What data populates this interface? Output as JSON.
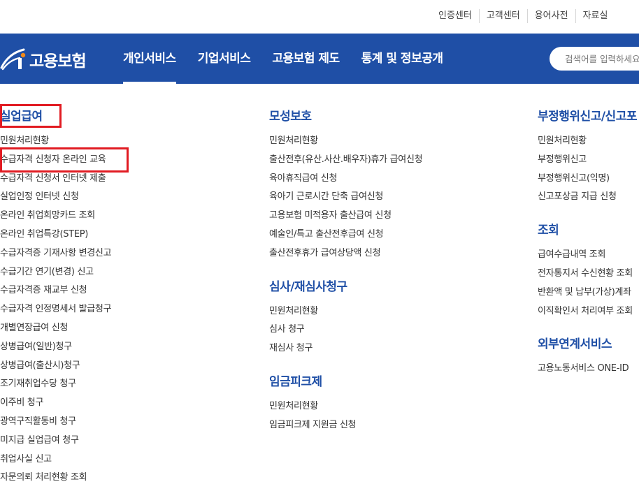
{
  "utility_links": [
    "인증센터",
    "고객센터",
    "용어사전",
    "자료실"
  ],
  "header": {
    "logo_text": "고용보험",
    "nav": [
      "개인서비스",
      "기업서비스",
      "고용보험 제도",
      "통계 및 정보공개"
    ],
    "active_nav": "개인서비스",
    "search_placeholder": "검색어를 입력하세요",
    "brand_color": "#1f4fa6",
    "highlight_color": "#e11b22"
  },
  "columns": {
    "col1": {
      "sections": [
        {
          "title": "실업급여",
          "items": [
            "민원처리현황",
            "수급자격 신청자 온라인 교육",
            "수급자격 신청서 인터넷 제출",
            "실업인정 인터넷 신청",
            "온라인 취업희망카드 조회",
            "온라인 취업특강(STEP)",
            "수급자격증 기재사항 변경신고",
            "수급기간 연기(변경) 신고",
            "수급자격증 재교부 신청",
            "수급자격 인정명세서 발급청구",
            "개별연장급여 신청",
            "상병급여(일반)청구",
            "상병급여(출산시)청구",
            "조기재취업수당 청구",
            "이주비 청구",
            "광역구직활동비 청구",
            "미지급 실업급여 청구",
            "취업사실 신고",
            "자문의뢰 처리현황 조회"
          ]
        }
      ]
    },
    "col2": {
      "sections": [
        {
          "title": "모성보호",
          "items": [
            "민원처리현황",
            "출산전후(유산.사산.배우자)휴가 급여신청",
            "육아휴직급여 신청",
            "육아기 근로시간 단축 급여신청",
            "고용보험 미적용자 출산급여 신청",
            "예술인/특고 출산전후급여 신청",
            "출산전후휴가 급여상당액 신청"
          ]
        },
        {
          "title": "심사/재심사청구",
          "items": [
            "민원처리현황",
            "심사 청구",
            "재심사 청구"
          ]
        },
        {
          "title": "임금피크제",
          "items": [
            "민원처리현황",
            "임금피크제 지원금 신청"
          ]
        }
      ]
    },
    "col3": {
      "sections": [
        {
          "title": "부정행위신고/신고포",
          "items": [
            "민원처리현황",
            "부정행위신고",
            "부정행위신고(익명)",
            "신고포상금 지급 신청"
          ]
        },
        {
          "title": "조회",
          "items": [
            "급여수급내역 조회",
            "전자통지서 수신현황 조회",
            "반환액 및 납부(가상)계좌",
            "이직확인서 처리여부 조회"
          ]
        },
        {
          "title": "외부연계서비스",
          "items": [
            "고용노동서비스 ONE-ID"
          ]
        }
      ]
    }
  }
}
